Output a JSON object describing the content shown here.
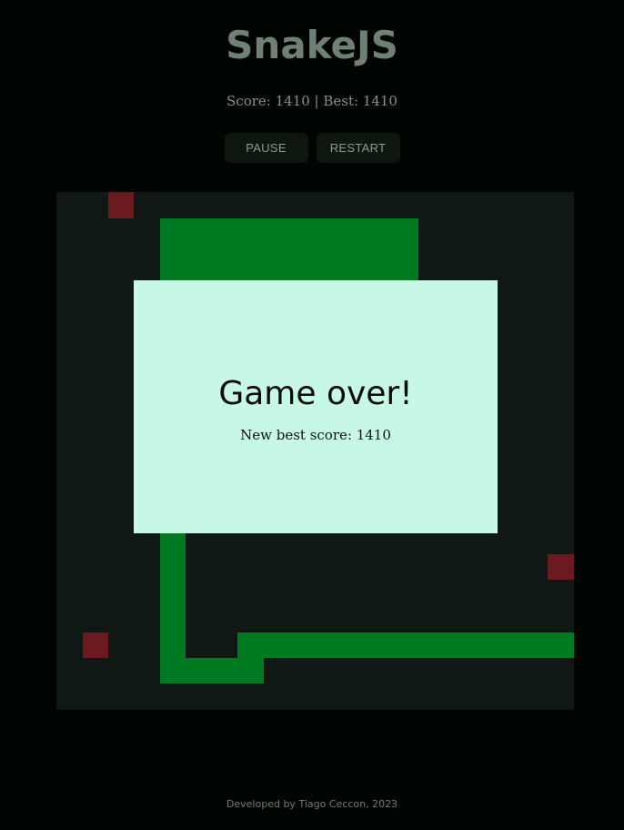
{
  "header": {
    "title": "SnakeJS",
    "score_text": "Score: 1410 | Best: 1410"
  },
  "controls": {
    "pause_label": "PAUSE",
    "restart_label": "RESTART"
  },
  "game": {
    "score": 1410,
    "best": 1410,
    "state": "game-over",
    "colors": {
      "snake": "#007a21",
      "food": "#6b1a1f",
      "board": "#0f1814"
    }
  },
  "overlay": {
    "title": "Game over!",
    "message": "New best score: 1410"
  },
  "footer": {
    "credit": "Developed by Tiago Ceccon, 2023"
  }
}
